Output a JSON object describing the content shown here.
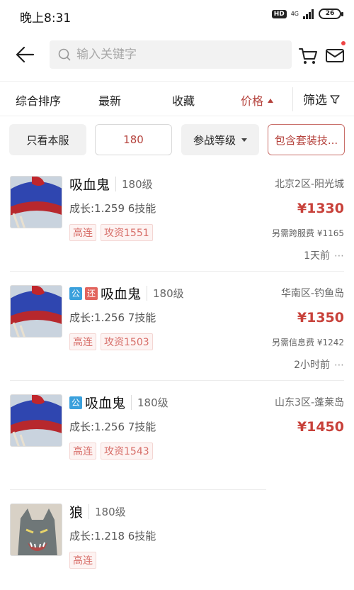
{
  "status": {
    "time": "晚上8:31",
    "hd": "HD",
    "network": "4G",
    "battery": "26"
  },
  "header": {
    "search_placeholder": "输入关键字"
  },
  "sort": {
    "items": [
      "综合排序",
      "最新",
      "收藏",
      "价格"
    ],
    "filter_label": "筛选"
  },
  "chips": {
    "only_server": "只看本服",
    "level_value": "180",
    "battle_level": "参战等级",
    "include_skills": "包含套装技..."
  },
  "listings": [
    {
      "badges": [],
      "name": "吸血鬼",
      "level": "180级",
      "growth": "成长:1.259 6技能",
      "tags": [
        "高连",
        "攻资1551"
      ],
      "server": "北京2区-阳光城",
      "price": "¥1330",
      "fee": "另需跨服费 ¥1165",
      "time": "1天前"
    },
    {
      "badges": [
        "公",
        "还"
      ],
      "name": "吸血鬼",
      "level": "180级",
      "growth": "成长:1.256 7技能",
      "tags": [
        "高连",
        "攻资1503"
      ],
      "server": "华南区-钓鱼岛",
      "price": "¥1350",
      "fee": "另需信息费 ¥1242",
      "time": "2小时前"
    },
    {
      "badges": [
        "公"
      ],
      "name": "吸血鬼",
      "level": "180级",
      "growth": "成长:1.256 7技能",
      "tags": [
        "高连",
        "攻资1543"
      ],
      "server": "山东3区-蓬莱岛",
      "price": "¥1450",
      "fee": "",
      "time": ""
    },
    {
      "badges": [],
      "name": "狼",
      "level": "180级",
      "growth": "成长:1.218 6技能",
      "tags": [
        "高连"
      ],
      "server": "",
      "price": "",
      "fee": "",
      "time": ""
    }
  ],
  "more_glyph": "⋯",
  "colors": {
    "accent": "#b5433d",
    "price": "#c8413a",
    "badge_blue": "#3aa0dc",
    "badge_red": "#e2645d"
  }
}
